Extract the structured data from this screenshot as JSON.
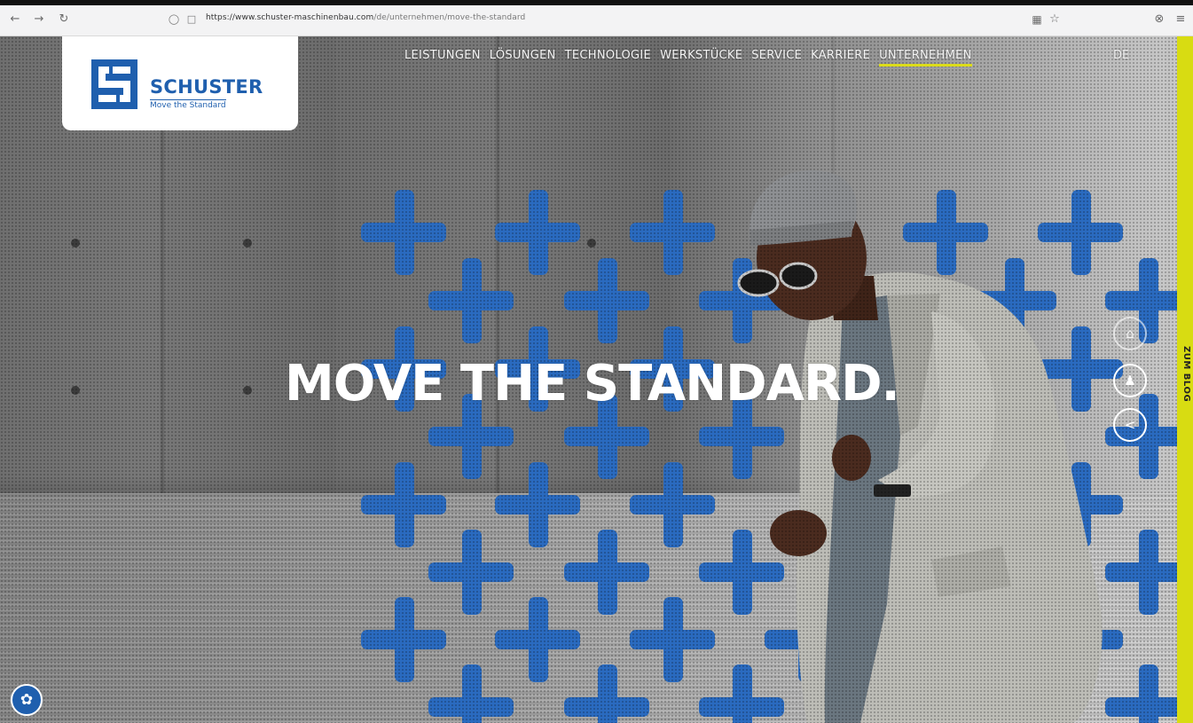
{
  "browser": {
    "back_icon": "arrow-left-icon",
    "forward_icon": "arrow-right-icon",
    "reload_icon": "reload-icon",
    "shield_icon": "shield-icon",
    "lock_icon": "lock-icon",
    "url_host": "https://www.schuster-maschinenbau.com",
    "url_path": "/de/unternehmen/move-the-standard",
    "reader_icon": "reader-view-icon",
    "bookmark_icon": "star-icon",
    "extension_icon": "extension-icon",
    "menu_icon": "menu-icon"
  },
  "brand": {
    "name": "SCHUSTER",
    "tagline": "Move the Standard",
    "color": "#1f5fae"
  },
  "nav": {
    "items": [
      {
        "label": "LEISTUNGEN",
        "active": false
      },
      {
        "label": "LÖSUNGEN",
        "active": false
      },
      {
        "label": "TECHNOLOGIE",
        "active": false
      },
      {
        "label": "WERKSTÜCKE",
        "active": false
      },
      {
        "label": "SERVICE",
        "active": false
      },
      {
        "label": "KARRIERE",
        "active": false
      },
      {
        "label": "UNTERNEHMEN",
        "active": true
      }
    ],
    "language": "DE",
    "active_underline_color": "#dcdc1a"
  },
  "hero": {
    "headline": "MOVE THE STANDARD.",
    "pattern_color": "#2a6bc0"
  },
  "side_actions": {
    "home_icon": "home-icon",
    "contact_icon": "person-icon",
    "share_icon": "share-icon"
  },
  "blog_tab": {
    "label": "ZUM BLOG",
    "color": "#d8dc12"
  },
  "cookie_badge": {
    "icon": "cookie-settings-icon"
  }
}
